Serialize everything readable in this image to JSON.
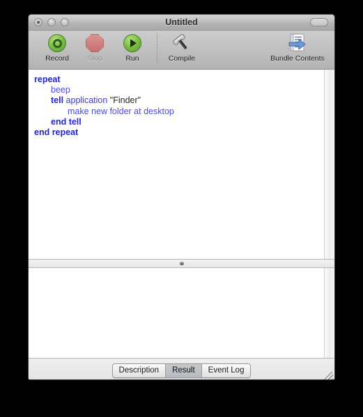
{
  "window": {
    "title": "Untitled",
    "traffic_lights": [
      {
        "name": "close",
        "label": "Close"
      },
      {
        "name": "minimize",
        "label": "Minimize"
      },
      {
        "name": "zoom",
        "label": "Zoom"
      }
    ],
    "toolbar_toggle_label": "Toggle Toolbar"
  },
  "toolbar": {
    "items": [
      {
        "id": "record",
        "label": "Record",
        "icon": "record-circle-icon",
        "enabled": true
      },
      {
        "id": "stop",
        "label": "Stop",
        "icon": "stop-octagon-icon",
        "enabled": false
      },
      {
        "id": "run",
        "label": "Run",
        "icon": "play-triangle-icon",
        "enabled": true
      },
      {
        "id": "compile",
        "label": "Compile",
        "icon": "hammer-icon",
        "enabled": true
      },
      {
        "id": "bundle_contents",
        "label": "Bundle Contents",
        "icon": "document-arrow-icon",
        "enabled": true
      }
    ]
  },
  "editor": {
    "language": "AppleScript",
    "lines": [
      {
        "indent": 0,
        "tokens": [
          {
            "text": "repeat",
            "style": "kw"
          }
        ]
      },
      {
        "indent": 1,
        "tokens": [
          {
            "text": "beep",
            "style": "cmd"
          }
        ]
      },
      {
        "indent": 1,
        "tokens": [
          {
            "text": "tell",
            "style": "kw"
          },
          {
            "text": " ",
            "style": "plain"
          },
          {
            "text": "application",
            "style": "app"
          },
          {
            "text": " ",
            "style": "plain"
          },
          {
            "text": "\"Finder\"",
            "style": "str"
          }
        ]
      },
      {
        "indent": 2,
        "tokens": [
          {
            "text": "make new folder at desktop",
            "style": "cmd"
          }
        ]
      },
      {
        "indent": 1,
        "tokens": [
          {
            "text": "end tell",
            "style": "kw"
          }
        ]
      },
      {
        "indent": 0,
        "tokens": [
          {
            "text": "end repeat",
            "style": "kw"
          }
        ]
      }
    ],
    "plain_text": "repeat\n\tbeep\n\ttell application \"Finder\"\n\t\tmake new folder at desktop\n\tend tell\nend repeat"
  },
  "result_pane": {
    "content": ""
  },
  "bottom_tabs": {
    "items": [
      {
        "id": "description",
        "label": "Description",
        "selected": false
      },
      {
        "id": "result",
        "label": "Result",
        "selected": true
      },
      {
        "id": "event_log",
        "label": "Event Log",
        "selected": false
      }
    ]
  },
  "colors": {
    "keyword_blue": "#2222dd",
    "command_blue": "#4a4ae6",
    "string_black": "#262626",
    "toolbar_gray": "#c0c0c0",
    "accent_green": "#7fc044",
    "stop_red": "#c46562"
  }
}
